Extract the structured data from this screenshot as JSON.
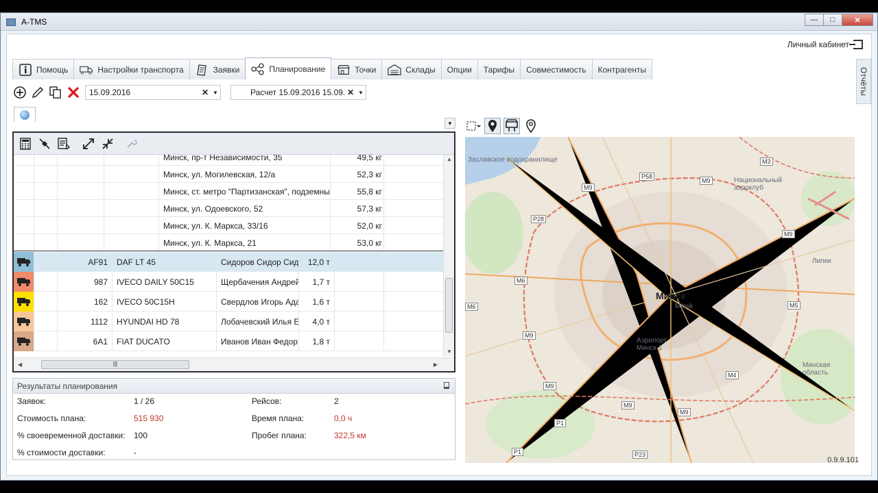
{
  "window": {
    "title": "A-TMS"
  },
  "header": {
    "cabinet_label": "Личный кабинет"
  },
  "tabs": [
    {
      "label": "Помощь",
      "icon": "info-icon"
    },
    {
      "label": "Настройки транспорта",
      "icon": "truck-icon"
    },
    {
      "label": "Заявки",
      "icon": "document-icon"
    },
    {
      "label": "Планирование",
      "icon": "share-nodes-icon",
      "active": true
    },
    {
      "label": "Точки",
      "icon": "store-icon"
    },
    {
      "label": "Склады",
      "icon": "warehouse-icon"
    },
    {
      "label": "Опции"
    },
    {
      "label": "Тарифы"
    },
    {
      "label": "Совместимость"
    },
    {
      "label": "Контрагенты"
    }
  ],
  "side_tab": {
    "label": "Отчёты"
  },
  "toolbar": {
    "date_value": "15.09.2016",
    "calc_value": "Расчет 15.09.2016 15.09.2"
  },
  "points": [
    {
      "address": "Минск, пр-т Независимости, 35",
      "weight": "49,5 кг"
    },
    {
      "address": "Минск, ул. Могилевская, 12/а",
      "weight": "52,3 кг"
    },
    {
      "address": "Минск, ст. метро \"Партизанская\", подземны",
      "weight": "55,8 кг"
    },
    {
      "address": "Минск, ул. Одоевского, 52",
      "weight": "57,3 кг"
    },
    {
      "address": "Минск, ул. К. Маркса, 33/16",
      "weight": "52,0 кг"
    },
    {
      "address": "Минск, ул. К. Маркса, 21",
      "weight": "53,0 кг"
    }
  ],
  "vehicles": [
    {
      "number": "AF91",
      "model": "DAF LT 45",
      "driver": "Сидоров Сидор  Сид",
      "capacity": "12,0 т",
      "color": "#8fbcd6"
    },
    {
      "number": "987",
      "model": "IVECO DAILY 50C15",
      "driver": "Щербачения Андрей",
      "capacity": "1,7 т",
      "color": "#f08a6a"
    },
    {
      "number": "162",
      "model": "IVECO 50C15H",
      "driver": "Свердлов Игорь Ада",
      "capacity": "1,6 т",
      "color": "#ffe000"
    },
    {
      "number": "1112",
      "model": "HYUNDAI HD 78",
      "driver": "Лобачевский Илья Е",
      "capacity": "4,0 т",
      "color": "#f6c898"
    },
    {
      "number": "6A1",
      "model": "FIAT DUCATO",
      "driver": "Иванов Иван Федор",
      "capacity": "1,8 т",
      "color": "#d8a888"
    }
  ],
  "results": {
    "title": "Результаты планирования",
    "requests_label": "Заявок:",
    "requests_value": "1 / 26",
    "trips_label": "Рейсов:",
    "trips_value": "2",
    "cost_label": "Стоимость плана:",
    "cost_value": "515 930",
    "time_label": "Время плана:",
    "time_value": "0,0 ч",
    "ontime_label": "% своевременной доставки:",
    "ontime_value": "100",
    "mileage_label": "Пробег плана:",
    "mileage_value": "322,5 км",
    "delivery_cost_label": "% стоимости доставки:",
    "delivery_cost_value": "-"
  },
  "map": {
    "city": "Минск",
    "city_sub": "Minsk",
    "labels": {
      "reservoir": "Заславское водохранилище",
      "aeroclub": "Национальный аэроклуб",
      "lipki": "Липки",
      "airport": "Аэропорт Минск-1",
      "region": "Минская область"
    },
    "roads": [
      "P58",
      "M9",
      "M9",
      "M3",
      "P28",
      "M6",
      "M9",
      "M9",
      "M5",
      "M4",
      "M9",
      "M9",
      "M9",
      "P1",
      "P1",
      "P23",
      "M6"
    ]
  },
  "status": {
    "version": "0.9.9.101"
  }
}
